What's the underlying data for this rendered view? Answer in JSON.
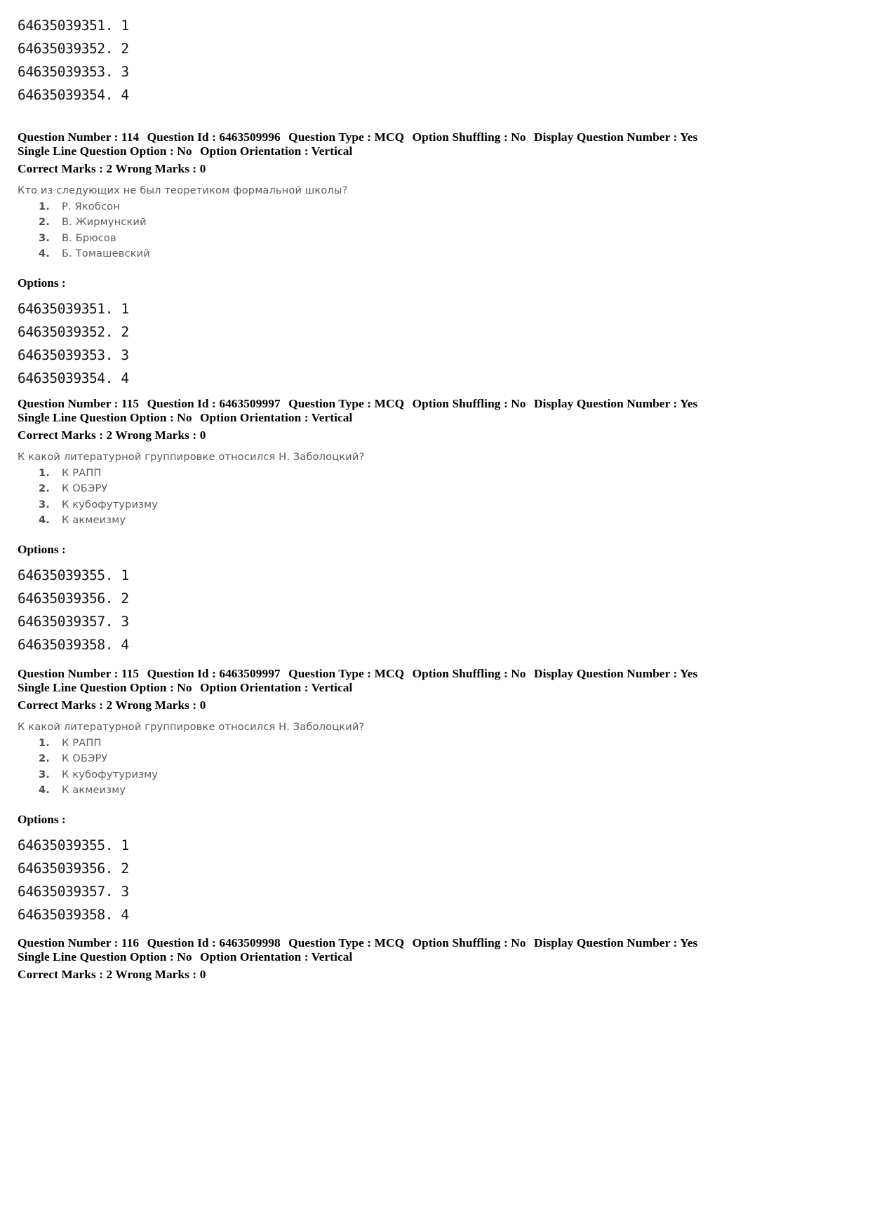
{
  "document": {
    "page_background": "#ffffff",
    "text_color": "#000000",
    "scan_text_color": "#5a5a5a"
  },
  "top_option_ids": [
    "64635039351. 1",
    "64635039352. 2",
    "64635039353. 3",
    "64635039354. 4"
  ],
  "labels": {
    "question_number": "Question Number :",
    "question_id": "Question Id :",
    "question_type": "Question Type :",
    "option_shuffling": "Option Shuffling :",
    "display_question_number": "Display Question Number :",
    "single_line_question_option": "Single Line Question Option :",
    "option_orientation": "Option Orientation :",
    "correct_marks": "Correct Marks :",
    "wrong_marks": "Wrong Marks :",
    "options": "Options :"
  },
  "blocks": [
    {
      "question_number": "114",
      "question_id": "6463509996",
      "question_type": "MCQ",
      "option_shuffling": "No",
      "display_question_number": "Yes",
      "single_line_question_option": "No",
      "option_orientation": "Vertical",
      "correct_marks": "2",
      "wrong_marks": "0",
      "stem": "Кто из следующих не был теоретиком формальной школы?",
      "choices": [
        {
          "num": "1.",
          "text": "Р. Якобсон"
        },
        {
          "num": "2.",
          "text": "В. Жирмунский"
        },
        {
          "num": "3.",
          "text": "В. Брюсов"
        },
        {
          "num": "4.",
          "text": "Б. Томашевский"
        }
      ],
      "option_ids": [
        "64635039351. 1",
        "64635039352. 2",
        "64635039353. 3",
        "64635039354. 4"
      ]
    },
    {
      "question_number": "115",
      "question_id": "6463509997",
      "question_type": "MCQ",
      "option_shuffling": "No",
      "display_question_number": "Yes",
      "single_line_question_option": "No",
      "option_orientation": "Vertical",
      "correct_marks": "2",
      "wrong_marks": "0",
      "stem": "К какой литературной группировке относился Н. Заболоцкий?",
      "choices": [
        {
          "num": "1.",
          "text": "К РАПП"
        },
        {
          "num": "2.",
          "text": "К ОБЭРУ"
        },
        {
          "num": "3.",
          "text": "К кубофутуризму"
        },
        {
          "num": "4.",
          "text": "К акмеизму"
        }
      ],
      "option_ids": [
        "64635039355. 1",
        "64635039356. 2",
        "64635039357. 3",
        "64635039358. 4"
      ]
    },
    {
      "question_number": "115",
      "question_id": "6463509997",
      "question_type": "MCQ",
      "option_shuffling": "No",
      "display_question_number": "Yes",
      "single_line_question_option": "No",
      "option_orientation": "Vertical",
      "correct_marks": "2",
      "wrong_marks": "0",
      "stem": "К какой литературной группировке относился Н. Заболоцкий?",
      "choices": [
        {
          "num": "1.",
          "text": "К РАПП"
        },
        {
          "num": "2.",
          "text": "К ОБЭРУ"
        },
        {
          "num": "3.",
          "text": "К кубофутуризму"
        },
        {
          "num": "4.",
          "text": "К акмеизму"
        }
      ],
      "option_ids": [
        "64635039355. 1",
        "64635039356. 2",
        "64635039357. 3",
        "64635039358. 4"
      ]
    },
    {
      "question_number": "116",
      "question_id": "6463509998",
      "question_type": "MCQ",
      "option_shuffling": "No",
      "display_question_number": "Yes",
      "single_line_question_option": "No",
      "option_orientation": "Vertical",
      "correct_marks": "2",
      "wrong_marks": "0",
      "stem": "",
      "choices": [],
      "option_ids": []
    }
  ]
}
